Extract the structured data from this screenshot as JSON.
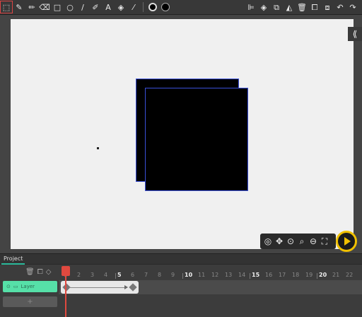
{
  "toolbar": {
    "left_tools": [
      {
        "name": "select-tool",
        "glyph": "⬚"
      },
      {
        "name": "brush-tool",
        "glyph": "✎"
      },
      {
        "name": "pencil-tool",
        "glyph": "✏"
      },
      {
        "name": "eraser-tool",
        "glyph": "⌫"
      },
      {
        "name": "rectangle-tool",
        "glyph": "□"
      },
      {
        "name": "ellipse-tool",
        "glyph": "○"
      },
      {
        "name": "line-tool",
        "glyph": "/"
      },
      {
        "name": "path-tool",
        "glyph": "✐"
      },
      {
        "name": "text-tool",
        "glyph": "A"
      },
      {
        "name": "fill-tool",
        "glyph": "◈"
      },
      {
        "name": "eyedropper-tool",
        "glyph": "⁄"
      }
    ],
    "right_tools": [
      {
        "name": "align-icon",
        "glyph": "⊫"
      },
      {
        "name": "layers-icon",
        "glyph": "◈"
      },
      {
        "name": "group-icon",
        "glyph": "⧉"
      },
      {
        "name": "flip-icon",
        "glyph": "◭"
      },
      {
        "name": "delete-icon",
        "glyph": "🗑"
      },
      {
        "name": "copy-icon",
        "glyph": "⧠"
      },
      {
        "name": "paste-icon",
        "glyph": "⧈"
      },
      {
        "name": "undo-icon",
        "glyph": "↶"
      },
      {
        "name": "redo-icon",
        "glyph": "↷"
      }
    ]
  },
  "canvas": {
    "collapse_glyph": "⟪"
  },
  "zoom_controls": [
    {
      "name": "onion-skin-icon",
      "glyph": "◎"
    },
    {
      "name": "pan-icon",
      "glyph": "✥"
    },
    {
      "name": "zoom-center-icon",
      "glyph": "⊙"
    },
    {
      "name": "zoom-in-icon",
      "glyph": "⌕"
    },
    {
      "name": "zoom-out-icon",
      "glyph": "⊖"
    },
    {
      "name": "fit-screen-icon",
      "glyph": "⛶"
    }
  ],
  "timeline": {
    "tab_label": "Project",
    "layer_name": "Layer",
    "add_layer_glyph": "+",
    "frame_labels": [
      "1",
      "2",
      "3",
      "4",
      "5",
      "6",
      "7",
      "8",
      "9",
      "10",
      "11",
      "12",
      "13",
      "14",
      "15",
      "16",
      "17",
      "18",
      "19",
      "20",
      "21",
      "22"
    ],
    "major_frames": [
      "5",
      "10",
      "15",
      "20"
    ]
  }
}
